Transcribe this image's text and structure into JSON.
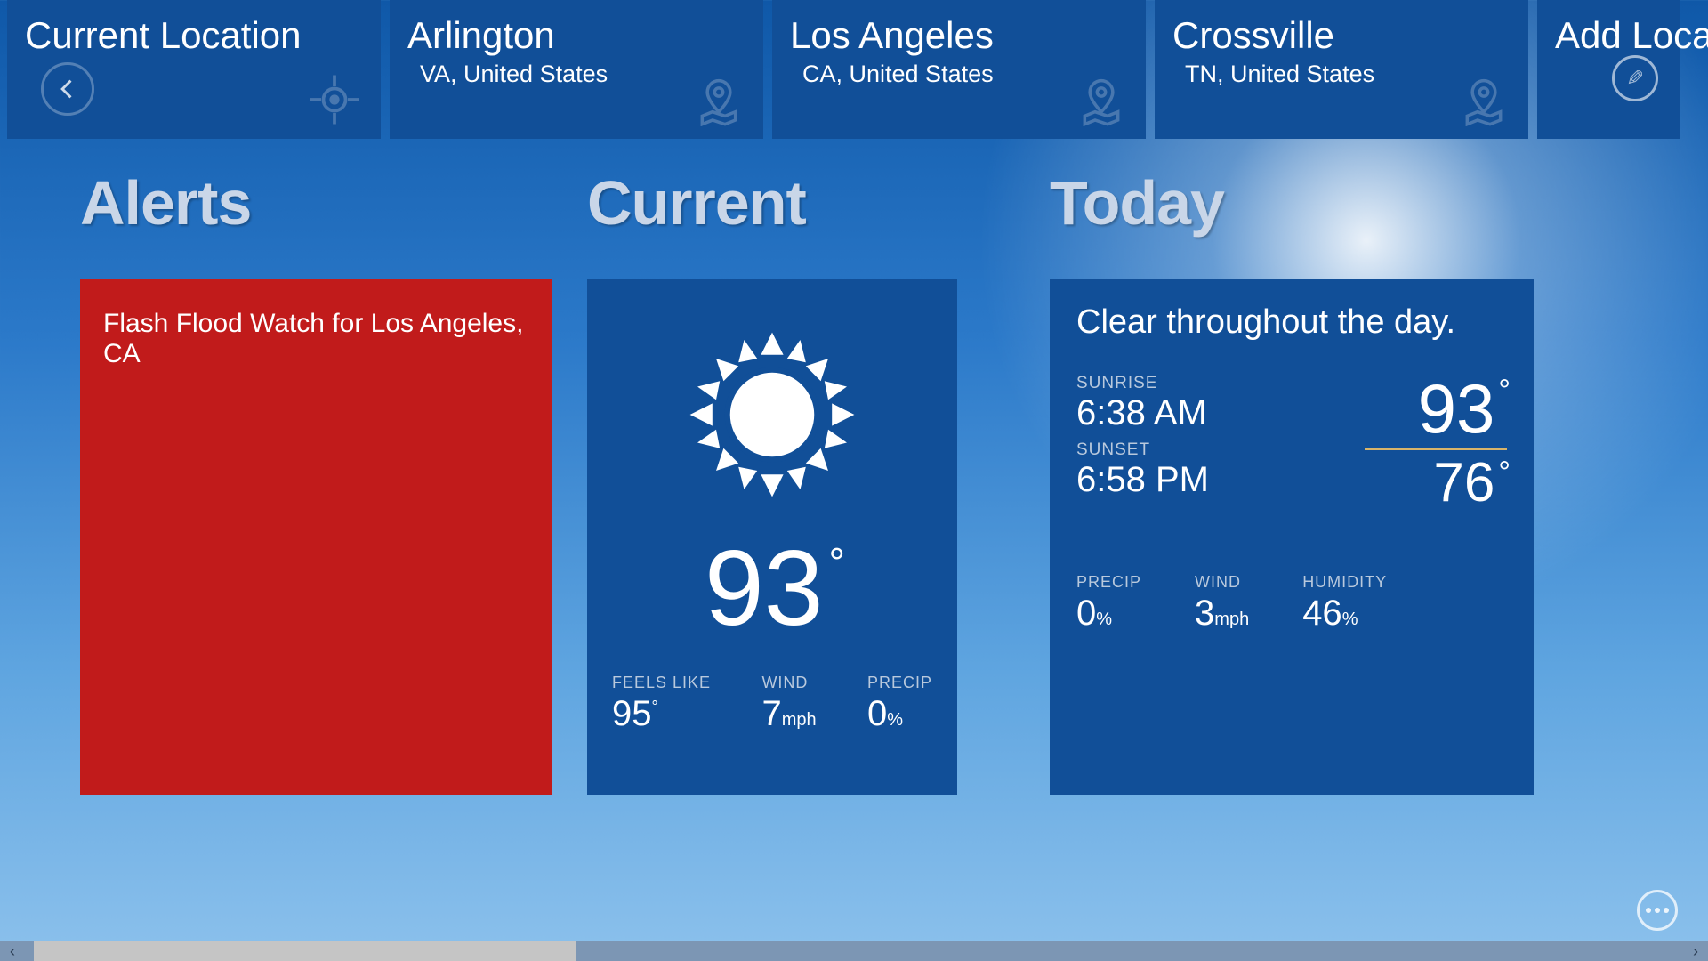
{
  "locations": {
    "current_label": "Current Location",
    "add_label": "Add Location",
    "tiles": [
      {
        "name": "Arlington",
        "region": "VA, United States"
      },
      {
        "name": "Los Angeles",
        "region": "CA, United States"
      },
      {
        "name": "Crossville",
        "region": "TN, United States"
      }
    ]
  },
  "sections": {
    "alerts_heading": "Alerts",
    "current_heading": "Current",
    "today_heading": "Today"
  },
  "alerts": {
    "text": "Flash Flood Watch for Los Angeles, CA"
  },
  "current": {
    "temp": "93",
    "feels_like_label": "FEELS LIKE",
    "feels_like": "95",
    "wind_label": "WIND",
    "wind_val": "7",
    "wind_unit": "mph",
    "precip_label": "PRECIP",
    "precip_val": "0",
    "precip_unit": "%"
  },
  "today": {
    "summary": "Clear throughout the day.",
    "sunrise_label": "SUNRISE",
    "sunrise": "6:38 AM",
    "sunset_label": "SUNSET",
    "sunset": "6:58 PM",
    "hi": "93",
    "lo": "76",
    "precip_label": "PRECIP",
    "precip_val": "0",
    "precip_unit": "%",
    "wind_label": "WIND",
    "wind_val": "3",
    "wind_unit": "mph",
    "humidity_label": "HUMIDITY",
    "humidity_val": "46",
    "humidity_unit": "%"
  }
}
